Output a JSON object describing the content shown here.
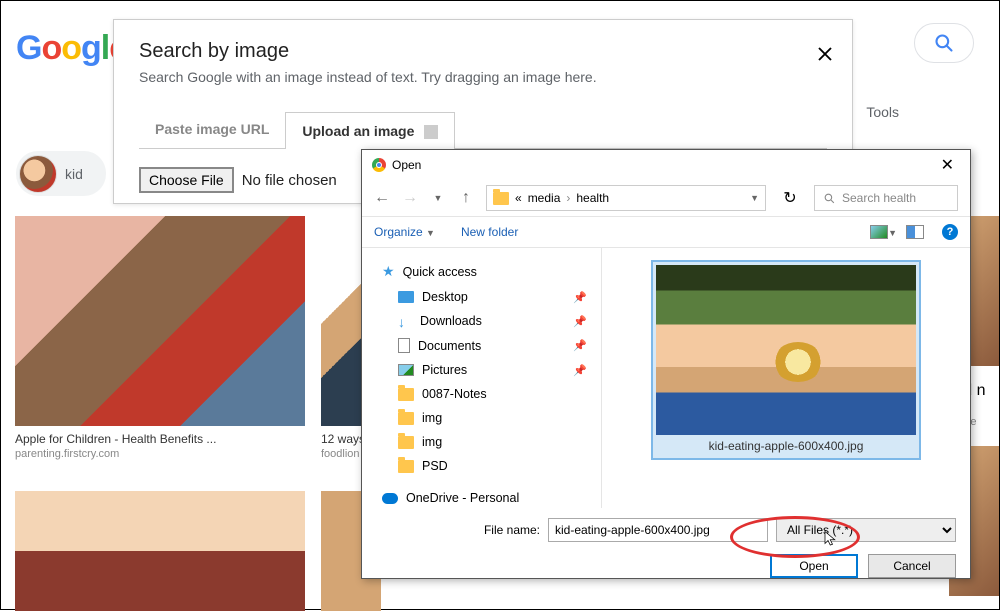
{
  "logo_text": "Google",
  "tools_label": "Tools",
  "sbi": {
    "title": "Search by image",
    "subtitle": "Search Google with an image instead of text. Try dragging an image here.",
    "tab_paste": "Paste image URL",
    "tab_upload": "Upload an image",
    "choose_file": "Choose File",
    "no_file": "No file chosen"
  },
  "chip_label": "kid",
  "results": [
    {
      "title": "Apple for Children - Health Benefits ...",
      "source": "parenting.firstcry.com"
    },
    {
      "title": "12 ways",
      "source": "foodlion"
    },
    {
      "title": "Kid n",
      "source": "thebe"
    }
  ],
  "fd": {
    "window_title": "Open",
    "path_prefix": "«",
    "path_seg1": "media",
    "path_seg2": "health",
    "search_placeholder": "Search health",
    "organize": "Organize",
    "new_folder": "New folder",
    "tree": {
      "quick_access": "Quick access",
      "desktop": "Desktop",
      "downloads": "Downloads",
      "documents": "Documents",
      "pictures": "Pictures",
      "notes": "0087-Notes",
      "img1": "img",
      "img2": "img",
      "psd": "PSD",
      "onedrive": "OneDrive - Personal"
    },
    "thumb_label": "kid-eating-apple-600x400.jpg",
    "filename_label": "File name:",
    "filename_value": "kid-eating-apple-600x400.jpg",
    "filter": "All Files (*.*)",
    "open": "Open",
    "cancel": "Cancel"
  }
}
